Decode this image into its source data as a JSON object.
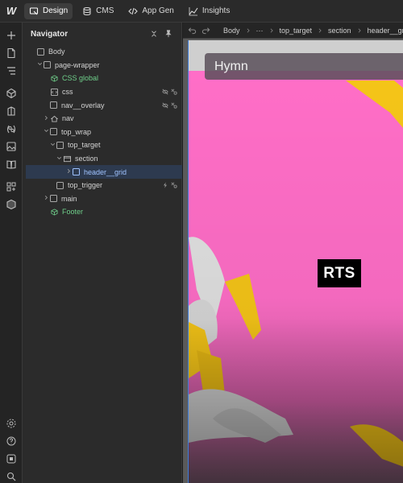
{
  "topbar": {
    "logo": "W",
    "tabs": [
      {
        "label": "Design",
        "icon": "design-icon",
        "active": true
      },
      {
        "label": "CMS",
        "icon": "database-icon",
        "active": false
      },
      {
        "label": "App Gen",
        "icon": "code-icon",
        "active": false
      },
      {
        "label": "Insights",
        "icon": "chart-icon",
        "active": false
      }
    ]
  },
  "rail": {
    "icons": [
      "add-icon",
      "page-icon",
      "navigator-icon",
      "components-icon",
      "style-selector-icon",
      "variables-icon",
      "assets-icon",
      "book-icon",
      "apps-icon",
      "box-icon",
      "settings-icon",
      "help-icon",
      "stop-icon",
      "search-icon"
    ]
  },
  "navigator": {
    "title": "Navigator",
    "tree": [
      {
        "label": "Body",
        "depth": 0,
        "chevron": "",
        "type": "box",
        "selected": false,
        "flags": []
      },
      {
        "label": "page-wrapper",
        "depth": 1,
        "chevron": "v",
        "type": "box",
        "selected": false,
        "flags": []
      },
      {
        "label": "CSS global",
        "depth": 2,
        "chevron": "",
        "type": "component",
        "selected": false,
        "flags": []
      },
      {
        "label": "css",
        "depth": 2,
        "chevron": "",
        "type": "code",
        "selected": false,
        "flags": [
          "hidden-icon",
          "custom-icon"
        ]
      },
      {
        "label": "nav__overlay",
        "depth": 2,
        "chevron": "",
        "type": "box",
        "selected": false,
        "flags": [
          "hidden-icon",
          "custom-icon"
        ]
      },
      {
        "label": "nav",
        "depth": 2,
        "chevron": ">",
        "type": "home",
        "selected": false,
        "flags": []
      },
      {
        "label": "top_wrap",
        "depth": 2,
        "chevron": "v",
        "type": "box",
        "selected": false,
        "flags": []
      },
      {
        "label": "top_target",
        "depth": 3,
        "chevron": "v",
        "type": "box",
        "selected": false,
        "flags": []
      },
      {
        "label": "section",
        "depth": 4,
        "chevron": "v",
        "type": "section",
        "selected": false,
        "flags": []
      },
      {
        "label": "header__grid",
        "depth": 5,
        "chevron": ">",
        "type": "box",
        "selected": true,
        "flags": []
      },
      {
        "label": "top_trigger",
        "depth": 3,
        "chevron": "",
        "type": "box",
        "selected": false,
        "flags": [
          "bolt-icon",
          "custom-icon"
        ]
      },
      {
        "label": "main",
        "depth": 2,
        "chevron": ">",
        "type": "box",
        "selected": false,
        "flags": []
      },
      {
        "label": "Footer",
        "depth": 2,
        "chevron": "",
        "type": "component",
        "selected": false,
        "flags": []
      }
    ]
  },
  "breadcrumb": {
    "items": [
      "Body",
      "···",
      "top_target",
      "section",
      "header__grid"
    ]
  },
  "canvas": {
    "heading": "Hymn",
    "logo_text": "RTS"
  },
  "colors": {
    "accent": "#3b7bd8",
    "component_green": "#6fcf8a",
    "pink": "#ff6ec7",
    "yellow": "#f5c518"
  }
}
